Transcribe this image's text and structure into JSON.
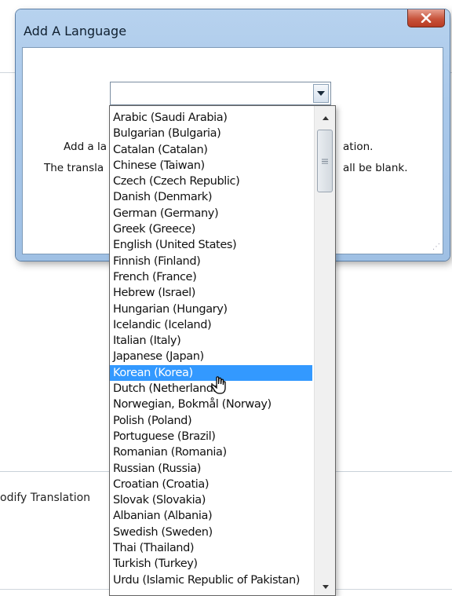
{
  "background": {
    "toolbar_text": "odify Translation"
  },
  "dialog": {
    "title": "Add A Language",
    "message_line1_left": "Add a la",
    "message_line1_right": "ation.",
    "message_line2_left": "The transla",
    "message_line2_right": "all be blank."
  },
  "combobox": {
    "value": ""
  },
  "dropdown": {
    "selected_index": 16,
    "items": [
      "Arabic (Saudi Arabia)",
      "Bulgarian (Bulgaria)",
      "Catalan (Catalan)",
      "Chinese (Taiwan)",
      "Czech (Czech Republic)",
      "Danish (Denmark)",
      "German (Germany)",
      "Greek (Greece)",
      "English (United States)",
      "Finnish (Finland)",
      "French (France)",
      "Hebrew (Israel)",
      "Hungarian (Hungary)",
      "Icelandic (Iceland)",
      "Italian (Italy)",
      "Japanese (Japan)",
      "Korean (Korea)",
      "Dutch (Netherlands)",
      "Norwegian, Bokmål (Norway)",
      "Polish (Poland)",
      "Portuguese (Brazil)",
      "Romanian (Romania)",
      "Russian (Russia)",
      "Croatian (Croatia)",
      "Slovak (Slovakia)",
      "Albanian (Albania)",
      "Swedish (Sweden)",
      "Thai (Thailand)",
      "Turkish (Turkey)",
      "Urdu (Islamic Republic of Pakistan)"
    ]
  },
  "colors": {
    "selection": "#3399ff",
    "close_button": "#c8533b",
    "dialog_frame": "#a9c8ea"
  }
}
